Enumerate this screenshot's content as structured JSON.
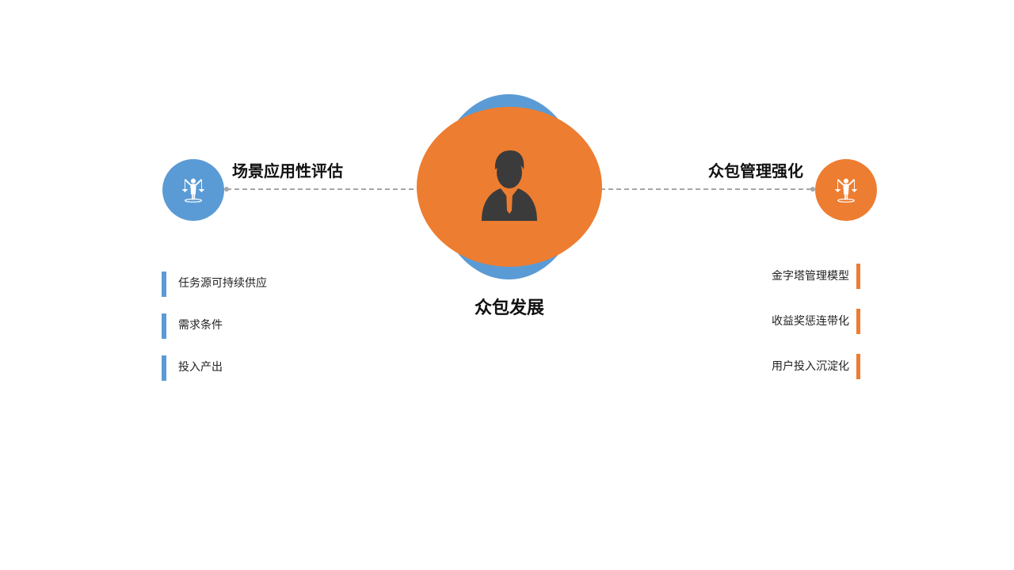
{
  "colors": {
    "blue": "#5b9bd5",
    "orange": "#ed7d31",
    "person": "#3b3b3b",
    "connector": "#a6a6a6"
  },
  "center": {
    "title": "众包发展",
    "icon": "person-icon"
  },
  "left_branch": {
    "title": "场景应用性评估",
    "icon": "balance-scale-person-icon",
    "items": [
      "任务源可持续供应",
      "需求条件",
      "投入产出"
    ]
  },
  "right_branch": {
    "title": "众包管理强化",
    "icon": "balance-scale-person-icon",
    "items": [
      "金字塔管理模型",
      "收益奖惩连带化",
      "用户投入沉淀化"
    ]
  }
}
